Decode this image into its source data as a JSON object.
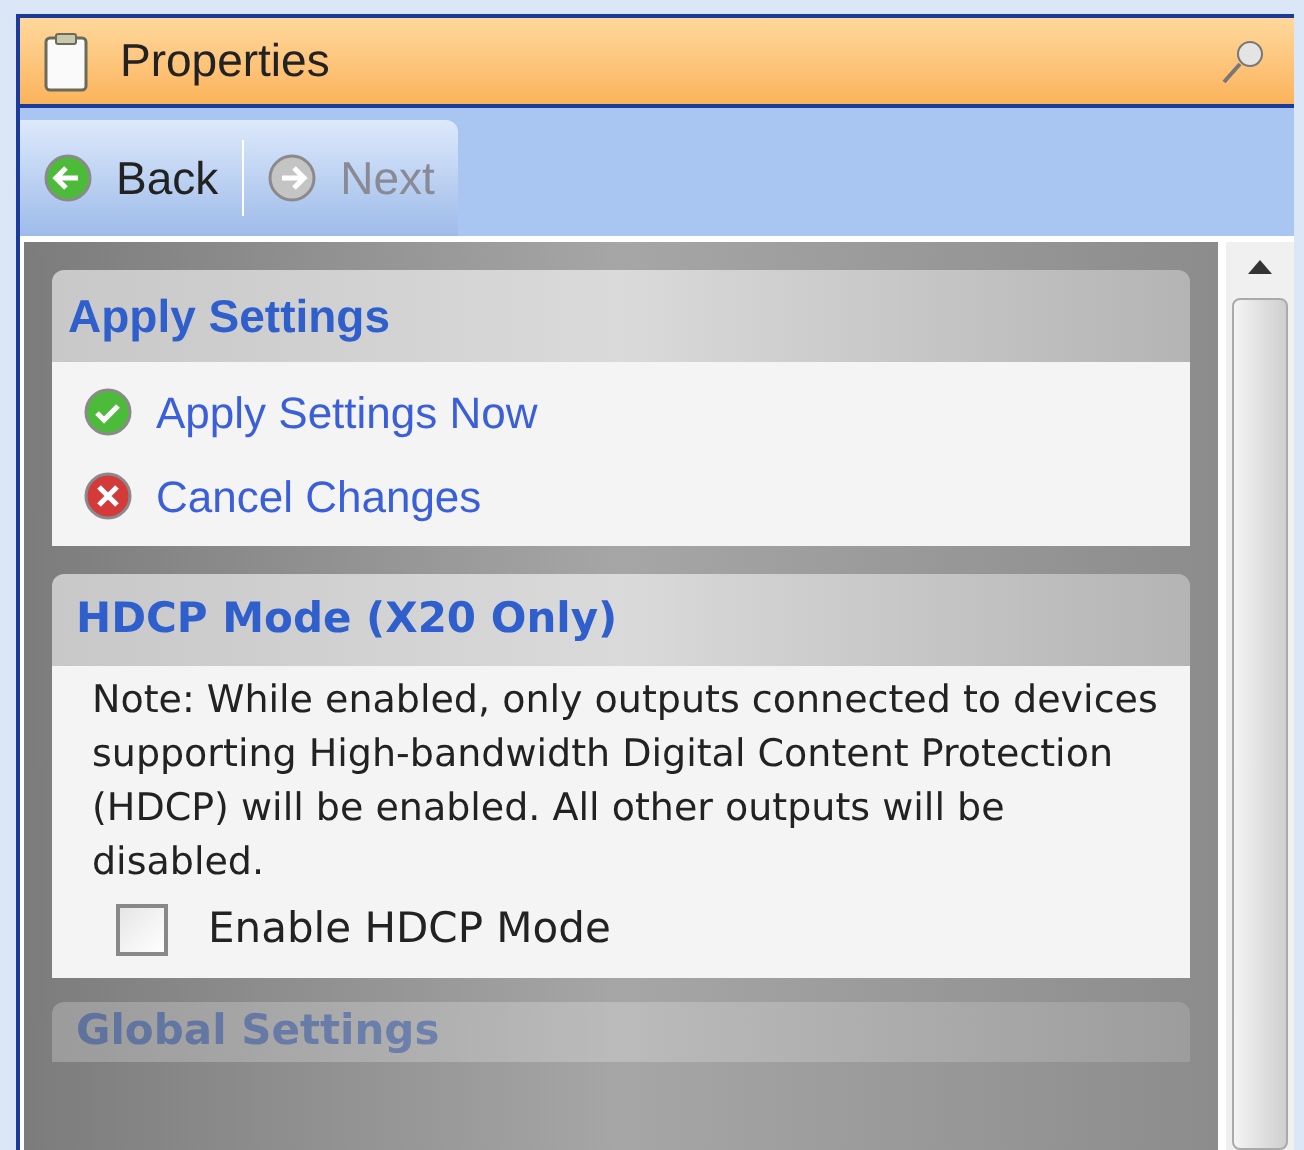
{
  "window": {
    "title": "Properties"
  },
  "toolbar": [
    {
      "kind": "back",
      "label": "Back",
      "disabled": false
    },
    {
      "kind": "next",
      "label": "Next",
      "disabled": true
    }
  ],
  "sections": [
    {
      "kind": "tasks",
      "title": "Apply Settings",
      "tasks": [
        {
          "kind": "apply",
          "label": "Apply Settings Now"
        },
        {
          "kind": "cancel",
          "label": "Cancel Changes"
        }
      ]
    },
    {
      "kind": "option",
      "title": "HDCP Mode (X20 Only)",
      "note": "Note: While enabled, only outputs connected to devices supporting High-bandwidth Digital Content Protection (HDCP) will be enabled. All other outputs will be disabled.",
      "checkbox": {
        "label": "Enable HDCP Mode",
        "checked": false
      }
    },
    {
      "kind": "collapsed",
      "title": "Global Settings"
    }
  ]
}
